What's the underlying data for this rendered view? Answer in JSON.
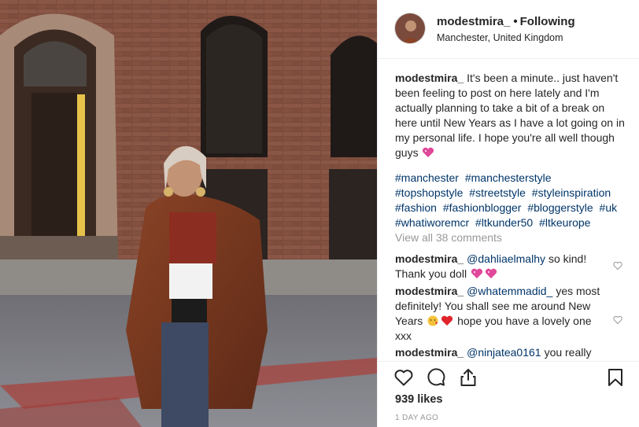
{
  "post": {
    "username": "modestmira_",
    "follow_status": "Following",
    "separator": "•",
    "location": "Manchester, United Kingdom"
  },
  "caption": {
    "username": "modestmira_",
    "text": "It's been a minute.. just haven't been feeling to post on here lately and I'm actually planning to take a bit of a break on here until New Years as I have a lot going on in my personal life. I hope you're all well though guys",
    "hashtags": [
      "#manchester",
      "#manchesterstyle",
      "#topshopstyle",
      "#streetstyle",
      "#styleinspiration",
      "#fashion",
      "#fashionblogger",
      "#bloggerstyle",
      "#uk",
      "#whatiworemcr",
      "#ltkunder50",
      "#ltkeurope"
    ]
  },
  "view_all_comments": "View all 38 comments",
  "comments": [
    {
      "username": "modestmira_",
      "mention": "@dahliaelmalhy",
      "text_before": "so kind! Thank you doll",
      "text_after": ""
    },
    {
      "username": "modestmira_",
      "mention": "@whatemmadid_",
      "text_before": "yes most definitely! You shall see me around New Years",
      "text_after": "hope you have a lovely one xxx"
    },
    {
      "username": "modestmira_",
      "mention": "@ninjatea0161",
      "text_before": "you really",
      "text_after": ""
    }
  ],
  "likes": "939 likes",
  "timestamp": "1 DAY AGO",
  "icons": {
    "like": "heart-outline-icon",
    "comment": "comment-bubble-icon",
    "share": "share-icon",
    "save": "bookmark-icon"
  },
  "colors": {
    "link": "#003569",
    "muted": "#999999",
    "text": "#262626",
    "emoji_heart": "#e0489a"
  }
}
